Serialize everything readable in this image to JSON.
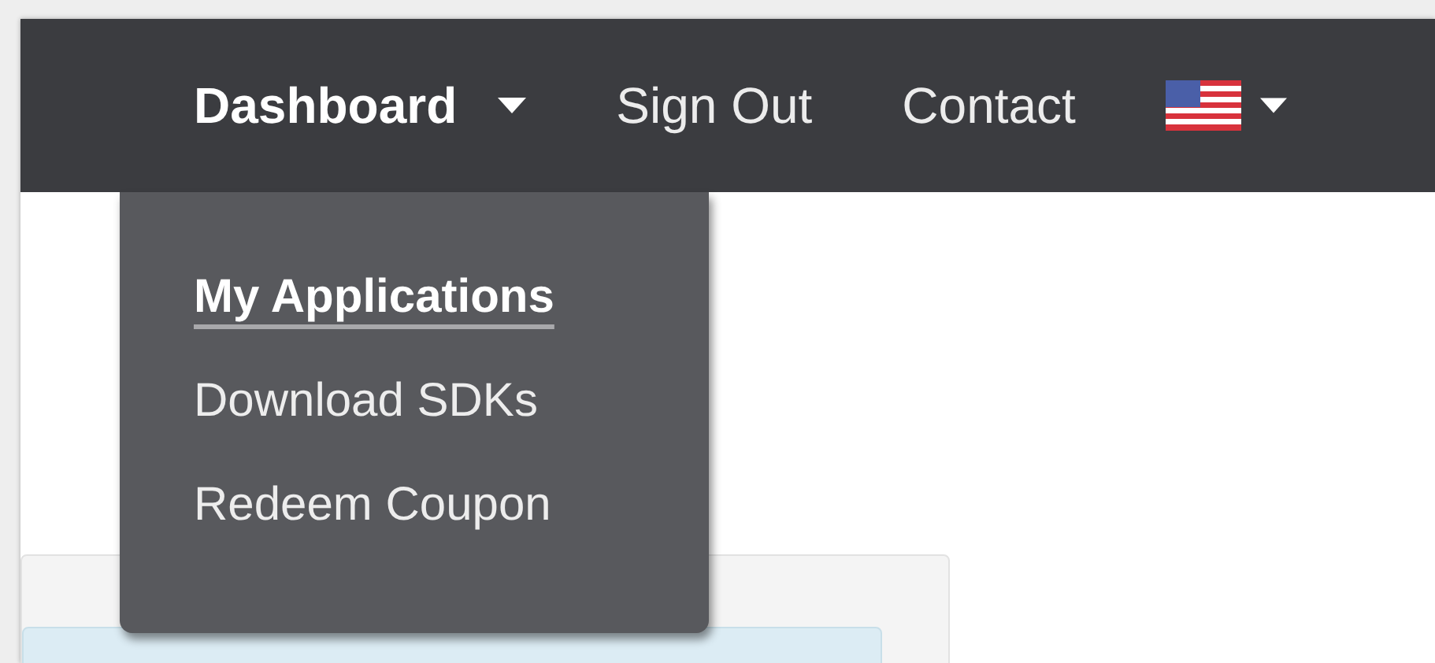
{
  "navbar": {
    "items": [
      {
        "label": "Dashboard",
        "selected": true,
        "kind": "dropdown"
      },
      {
        "label": "Sign Out",
        "selected": false,
        "kind": "link"
      },
      {
        "label": "Contact",
        "selected": false,
        "kind": "link"
      }
    ]
  },
  "dashboard_menu": {
    "items": [
      {
        "label": "My Applications",
        "selected": true
      },
      {
        "label": "Download SDKs",
        "selected": false
      },
      {
        "label": "Redeem Coupon",
        "selected": false
      }
    ]
  }
}
